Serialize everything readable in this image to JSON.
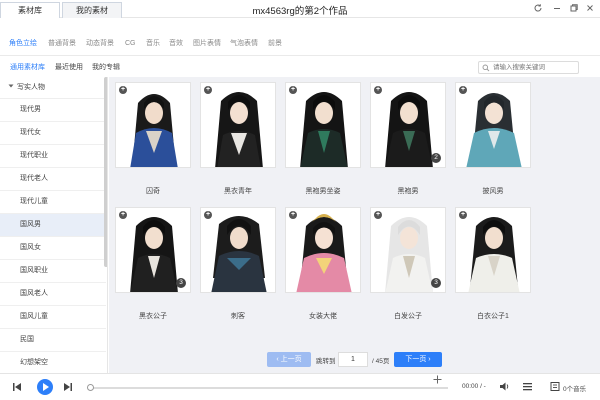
{
  "window": {
    "title": "mx4563rg的第2个作品"
  },
  "top_tabs": [
    {
      "label": "素材库",
      "active": true
    },
    {
      "label": "我的素材",
      "active": false
    }
  ],
  "category_tabs": [
    {
      "label": "角色立绘",
      "active": true
    },
    {
      "label": "普通背景"
    },
    {
      "label": "动态背景"
    },
    {
      "label": "CG"
    },
    {
      "label": "音乐"
    },
    {
      "label": "音效"
    },
    {
      "label": "图片表情"
    },
    {
      "label": "气泡表情"
    },
    {
      "label": "前景"
    }
  ],
  "sub_tabs": [
    {
      "label": "通用素材库",
      "active": true
    },
    {
      "label": "最近使用"
    },
    {
      "label": "我的专辑"
    }
  ],
  "search": {
    "placeholder": "请输入搜索关键词"
  },
  "sidebar": {
    "header": "写实人物",
    "items": [
      {
        "label": "现代男"
      },
      {
        "label": "现代女"
      },
      {
        "label": "现代职业"
      },
      {
        "label": "现代老人"
      },
      {
        "label": "现代儿童"
      },
      {
        "label": "国风男",
        "active": true
      },
      {
        "label": "国风女"
      },
      {
        "label": "国风职业"
      },
      {
        "label": "国风老人"
      },
      {
        "label": "国风儿童"
      },
      {
        "label": "民国"
      },
      {
        "label": "幻想架空"
      }
    ]
  },
  "cards": [
    {
      "label": "囚奇",
      "icon": "character-portrait-icon"
    },
    {
      "label": "黑衣青年",
      "icon": "character-portrait-icon"
    },
    {
      "label": "黑袍男坐姿",
      "icon": "character-portrait-icon"
    },
    {
      "label": "黑袍男",
      "icon": "character-portrait-icon",
      "badge": "2"
    },
    {
      "label": "披风男",
      "icon": "character-portrait-icon"
    },
    {
      "label": "黑衣公子",
      "icon": "character-portrait-icon",
      "badge": "3"
    },
    {
      "label": "刺客",
      "icon": "character-portrait-icon"
    },
    {
      "label": "女装大佬",
      "icon": "character-portrait-icon"
    },
    {
      "label": "白发公子",
      "icon": "character-portrait-icon",
      "badge": "3"
    },
    {
      "label": "白衣公子1",
      "icon": "character-portrait-icon"
    }
  ],
  "pager": {
    "prev_label": "上一页",
    "jump_label": "跳转到",
    "current_page": "1",
    "total_label": "/ 45页",
    "next_label": "下一页"
  },
  "player": {
    "time": "00:00 / -",
    "track_count": "0个音乐"
  },
  "colors": {
    "accent": "#2d7ff9",
    "accent_light": "#9ebcf2",
    "content_bg": "#f0f1f5",
    "sidebar_active": "#e8eef8"
  }
}
